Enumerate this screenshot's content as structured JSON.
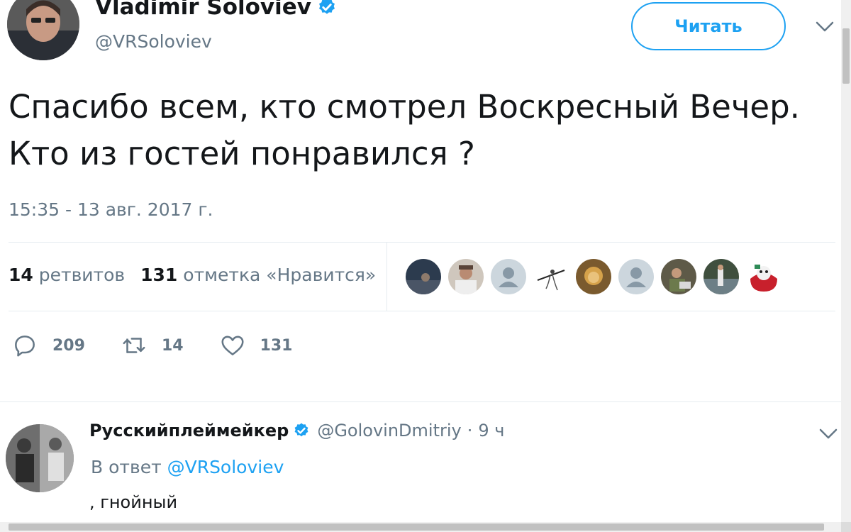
{
  "tweet": {
    "author_name": "Vladimir Soloviev",
    "author_handle": "@VRSoloviev",
    "follow_label": "Читать",
    "text": "Спасибо всем, кто смотрел Воскресный Вечер. Кто из гостей понравился ?",
    "timestamp": "15:35 - 13 авг. 2017 г.",
    "stats": {
      "retweets_count": "14",
      "retweets_label": "ретвитов",
      "likes_count": "131",
      "likes_label": "отметка «Нравится»"
    },
    "likers": [
      "photo",
      "photo",
      "default",
      "drawing",
      "photo",
      "default",
      "photo",
      "photo",
      "mascot"
    ],
    "actions": {
      "replies": "209",
      "retweets": "14",
      "likes": "131"
    }
  },
  "reply": {
    "author_name": "Русскийплеймейкер",
    "author_handle": "@GolovinDmitriy",
    "time_sep": "·",
    "time": "9 ч",
    "reply_to_prefix": "В ответ",
    "reply_to_handle": "@VRSoloviev",
    "text": ", гнойный"
  },
  "colors": {
    "accent": "#1da1f2",
    "muted": "#657786",
    "text": "#14171a",
    "border": "#e6ecf0"
  },
  "icons": [
    "verified-badge-icon",
    "chevron-down-icon",
    "reply-icon",
    "retweet-icon",
    "heart-icon"
  ]
}
